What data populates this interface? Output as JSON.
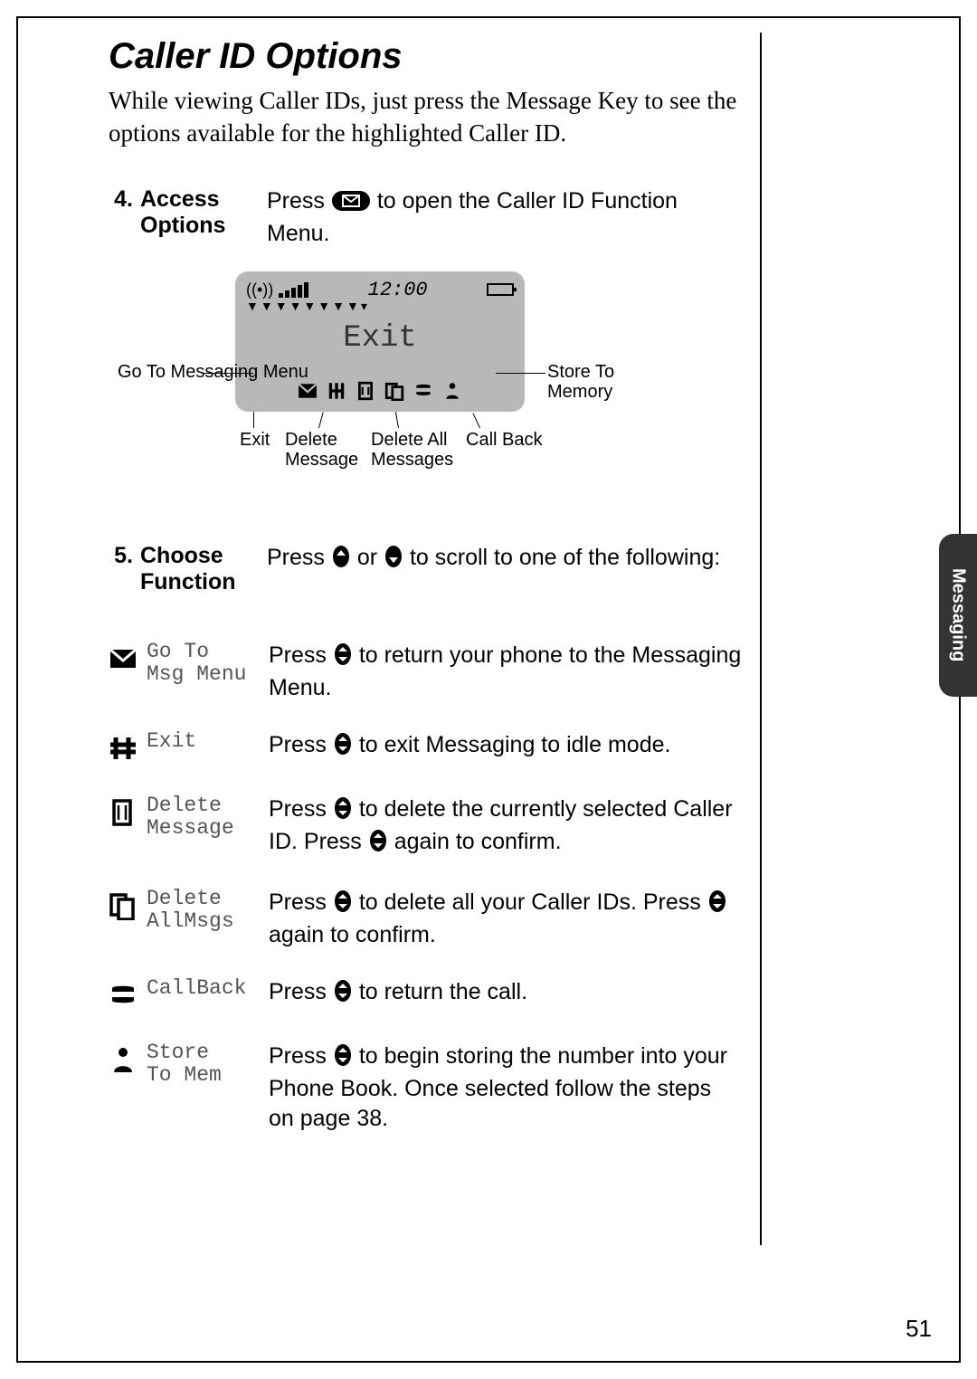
{
  "title": "Caller ID Options",
  "intro": "While viewing Caller IDs, just press the Message Key to see the options available for the highlighted Caller ID.",
  "side_tab": "Messaging",
  "page_number": "51",
  "steps": [
    {
      "num": "4.",
      "label": "Access Options",
      "body_pre": "Press",
      "body_post": "to open the Caller ID Function Menu.",
      "icon": "envelope"
    },
    {
      "num": "5.",
      "label": "Choose Function",
      "body_pre": "Press",
      "body_mid": "or",
      "body_post": "to scroll to one of the following:",
      "icon_pair": true
    }
  ],
  "diagram": {
    "clock": "12:00",
    "main_text": "Exit",
    "callouts": {
      "left": "Go To Messaging Menu",
      "right": "Store To Memory",
      "bottom": [
        "Exit",
        "Delete Message",
        "Delete All Messages",
        "Call Back"
      ]
    }
  },
  "functions": [
    {
      "icon": "msg",
      "label_l1": "Go To",
      "label_l2": "Msg Menu",
      "body_pre": "Press",
      "body_post": "to return your phone to the Messaging Menu."
    },
    {
      "icon": "hash",
      "label_l1": "Exit",
      "label_l2": "",
      "body_pre": "Press",
      "body_post": "to exit Messaging to idle mode."
    },
    {
      "icon": "page",
      "label_l1": "Delete",
      "label_l2": "Message",
      "body_pre": "Press",
      "body_mid": "to delete the currently selected Caller ID. Press",
      "body_post": "again to confirm."
    },
    {
      "icon": "pages",
      "label_l1": "Delete",
      "label_l2": "AllMsgs",
      "body_pre": "Press",
      "body_mid": "to delete all your Caller IDs. Press",
      "body_post": "again to confirm."
    },
    {
      "icon": "phone",
      "label_l1": "CallBack",
      "label_l2": "",
      "body_pre": "Press",
      "body_post": "to return the call."
    },
    {
      "icon": "person",
      "label_l1": "Store",
      "label_l2": "To  Mem",
      "body_pre": "Press",
      "body_post": "to begin storing the number into your Phone Book. Once selected follow the steps on page 38."
    }
  ]
}
